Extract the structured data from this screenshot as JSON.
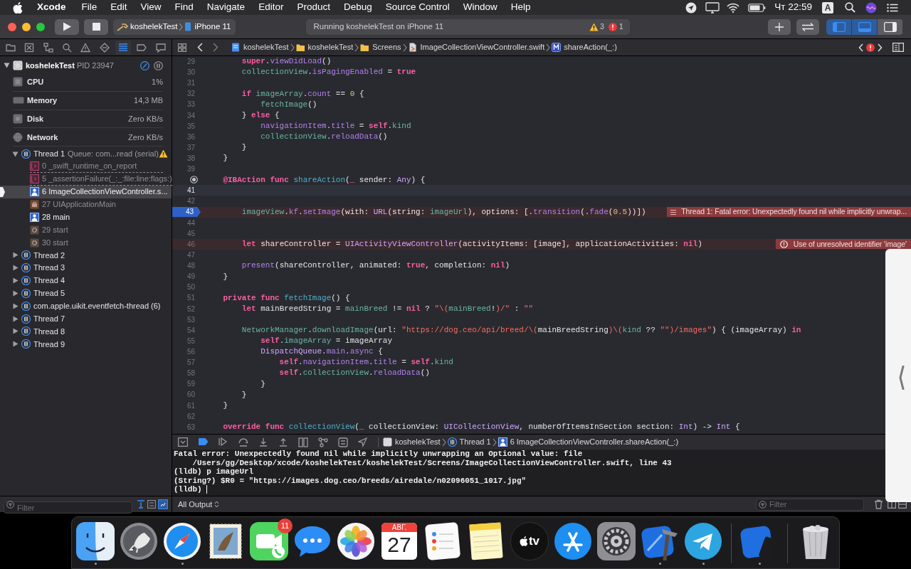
{
  "menu_bar": {
    "menus": [
      {
        "label": "Xcode",
        "kind": "app"
      },
      {
        "label": "File",
        "kind": "menu"
      },
      {
        "label": "Edit",
        "kind": "menu"
      },
      {
        "label": "View",
        "kind": "menu"
      },
      {
        "label": "Find",
        "kind": "menu"
      },
      {
        "label": "Navigate",
        "kind": "menu"
      },
      {
        "label": "Editor",
        "kind": "menu"
      },
      {
        "label": "Product",
        "kind": "menu"
      },
      {
        "label": "Debug",
        "kind": "menu"
      },
      {
        "label": "Source Control",
        "kind": "menu"
      },
      {
        "label": "Window",
        "kind": "menu"
      },
      {
        "label": "Help",
        "kind": "menu"
      }
    ],
    "clock": "Чт 22:59",
    "input_source": "A"
  },
  "toolbar": {
    "scheme": "koshelekTest",
    "device": "iPhone 11",
    "status": "Running koshelekTest on iPhone 11",
    "warnings": "3",
    "errors": "1",
    "layout_buttons": [
      {
        "kind": "navigator",
        "selected": true
      },
      {
        "kind": "debug",
        "selected": true
      },
      {
        "kind": "inspector",
        "selected": false
      }
    ]
  },
  "navigator_tabs": [
    {
      "kind": "project",
      "selected": false
    },
    {
      "kind": "source",
      "selected": false
    },
    {
      "kind": "symbols",
      "selected": false
    },
    {
      "kind": "find",
      "selected": false
    },
    {
      "kind": "issues",
      "selected": false
    },
    {
      "kind": "tests",
      "selected": false
    },
    {
      "kind": "debug",
      "selected": true
    },
    {
      "kind": "breakpoints",
      "selected": false
    },
    {
      "kind": "reports",
      "selected": false
    }
  ],
  "jump_bar": [
    {
      "label": "koshelekTest",
      "kind": "project"
    },
    {
      "label": "koshelekTest",
      "kind": "folder"
    },
    {
      "label": "Screens",
      "kind": "folder"
    },
    {
      "label": "ImageCollectionViewController.swift",
      "kind": "file"
    },
    {
      "label": "shareAction(_:)",
      "kind": "method"
    }
  ],
  "debug_navigator": {
    "process": "koshelekTest",
    "pid": "PID 23947",
    "gauges": [
      {
        "kind": "cpu",
        "label": "CPU",
        "value": "1%"
      },
      {
        "kind": "memory",
        "label": "Memory",
        "value": "14,3 MB"
      },
      {
        "kind": "disk",
        "label": "Disk",
        "value": "Zero KB/s"
      },
      {
        "kind": "network",
        "label": "Network",
        "value": "Zero KB/s"
      }
    ],
    "threads": [
      {
        "label": "Thread 1",
        "queue": "Queue: com...read (serial)",
        "expanded": true,
        "warning": true,
        "children": [
          {
            "label": "0 _swift_runtime_on_report",
            "kind": "runtime",
            "selected": false
          },
          {
            "label": "5 _assertionFailure(_:_:file:line:flags:)",
            "kind": "runtime",
            "selected": false
          },
          {
            "label": "6 ImageCollectionViewController.s...",
            "kind": "user",
            "selected": true
          },
          {
            "label": "27 UIApplicationMain",
            "kind": "framework",
            "selected": false
          },
          {
            "label": "28 main",
            "kind": "user",
            "selected": false
          },
          {
            "label": "29 start",
            "kind": "system",
            "selected": false
          },
          {
            "label": "30 start",
            "kind": "system",
            "selected": false
          }
        ]
      },
      {
        "label": "Thread 2",
        "expanded": false,
        "warning": false
      },
      {
        "label": "Thread 3",
        "expanded": false,
        "warning": false
      },
      {
        "label": "Thread 4",
        "expanded": false,
        "warning": false
      },
      {
        "label": "Thread 5",
        "expanded": false,
        "warning": false
      },
      {
        "label": "com.apple.uikit.eventfetch-thread (6)",
        "expanded": false,
        "warning": false
      },
      {
        "label": "Thread 7",
        "expanded": false,
        "warning": false
      },
      {
        "label": "Thread 8",
        "expanded": false,
        "warning": false
      },
      {
        "label": "Thread 9",
        "expanded": false,
        "warning": false
      }
    ],
    "filter": {
      "placeholder": "Filter"
    }
  },
  "editor": {
    "lines": [
      {
        "number": "29",
        "kind": "plain",
        "tokens": [
          {
            "kind": "kw",
            "text": "        super"
          },
          {
            "kind": "p",
            "text": "."
          },
          {
            "kind": "sys",
            "text": "viewDidLoad"
          },
          {
            "kind": "p",
            "text": "()"
          }
        ]
      },
      {
        "number": "30",
        "kind": "plain",
        "tokens": [
          {
            "kind": "proj",
            "text": "        collectionView"
          },
          {
            "kind": "p",
            "text": "."
          },
          {
            "kind": "sys",
            "text": "isPagingEnabled"
          },
          {
            "kind": "p",
            "text": " = "
          },
          {
            "kind": "kw",
            "text": "true"
          }
        ]
      },
      {
        "number": "31",
        "kind": "plain"
      },
      {
        "number": "32",
        "kind": "plain",
        "tokens": [
          {
            "kind": "kw",
            "text": "        if"
          },
          {
            "kind": "proj",
            "text": " imageArray"
          },
          {
            "kind": "p",
            "text": "."
          },
          {
            "kind": "sys",
            "text": "count"
          },
          {
            "kind": "p",
            "text": " == "
          },
          {
            "kind": "num",
            "text": "0"
          },
          {
            "kind": "p",
            "text": " {"
          }
        ]
      },
      {
        "number": "33",
        "kind": "plain",
        "tokens": [
          {
            "kind": "proj",
            "text": "            fetchImage"
          },
          {
            "kind": "p",
            "text": "()"
          }
        ]
      },
      {
        "number": "34",
        "kind": "plain",
        "tokens": [
          {
            "kind": "p",
            "text": "        } "
          },
          {
            "kind": "kw",
            "text": "else"
          },
          {
            "kind": "p",
            "text": " {"
          }
        ]
      },
      {
        "number": "35",
        "kind": "plain",
        "tokens": [
          {
            "kind": "sys",
            "text": "            navigationItem"
          },
          {
            "kind": "p",
            "text": "."
          },
          {
            "kind": "sys",
            "text": "title"
          },
          {
            "kind": "p",
            "text": " = "
          },
          {
            "kind": "kw",
            "text": "self"
          },
          {
            "kind": "p",
            "text": "."
          },
          {
            "kind": "proj",
            "text": "kind"
          }
        ]
      },
      {
        "number": "36",
        "kind": "plain",
        "tokens": [
          {
            "kind": "proj",
            "text": "            collectionView"
          },
          {
            "kind": "p",
            "text": "."
          },
          {
            "kind": "sys",
            "text": "reloadData"
          },
          {
            "kind": "p",
            "text": "()"
          }
        ]
      },
      {
        "number": "37",
        "kind": "plain",
        "tokens": [
          {
            "kind": "p",
            "text": "        }"
          }
        ]
      },
      {
        "number": "38",
        "kind": "plain",
        "tokens": [
          {
            "kind": "p",
            "text": "    }"
          }
        ]
      },
      {
        "number": "39",
        "kind": "plain"
      },
      {
        "kind": "outlet",
        "tokens": [
          {
            "kind": "kw",
            "text": "    @IBAction func"
          },
          {
            "kind": "decl",
            "text": " shareAction"
          },
          {
            "kind": "p",
            "text": "("
          },
          {
            "kind": "kw",
            "text": "_"
          },
          {
            "kind": "p",
            "text": " sender: "
          },
          {
            "kind": "type",
            "text": "Any"
          },
          {
            "kind": "p",
            "text": ") {"
          }
        ]
      },
      {
        "number": "41",
        "kind": "current"
      },
      {
        "number": "42",
        "kind": "plain"
      },
      {
        "number": "43",
        "kind": "stopped",
        "issue": "Thread 1: Fatal error: Unexpectedly found nil while implicitly unwrap...",
        "tokens": [
          {
            "kind": "proj",
            "text": "        imageView"
          },
          {
            "kind": "p",
            "text": "."
          },
          {
            "kind": "sys",
            "text": "kf"
          },
          {
            "kind": "p",
            "text": "."
          },
          {
            "kind": "sys",
            "text": "setImage"
          },
          {
            "kind": "p",
            "text": "(with: "
          },
          {
            "kind": "type",
            "text": "URL"
          },
          {
            "kind": "p",
            "text": "(string: "
          },
          {
            "kind": "proj",
            "text": "imageUrl"
          },
          {
            "kind": "p",
            "text": "), options: [."
          },
          {
            "kind": "sys",
            "text": "transition"
          },
          {
            "kind": "p",
            "text": "(."
          },
          {
            "kind": "sys",
            "text": "fade"
          },
          {
            "kind": "p",
            "text": "("
          },
          {
            "kind": "num",
            "text": "0.5"
          },
          {
            "kind": "p",
            "text": "))])"
          }
        ]
      },
      {
        "number": "44",
        "kind": "plain"
      },
      {
        "number": "45",
        "kind": "plain"
      },
      {
        "number": "46",
        "kind": "error",
        "issue": "Use of unresolved identifier 'image'",
        "tokens": [
          {
            "kind": "kw",
            "text": "        let"
          },
          {
            "kind": "p",
            "text": " shareController = "
          },
          {
            "kind": "type",
            "text": "UIActivityViewController"
          },
          {
            "kind": "p",
            "text": "(activityItems: [image], applicationActivities: "
          },
          {
            "kind": "kw",
            "text": "nil"
          },
          {
            "kind": "p",
            "text": ")"
          }
        ]
      },
      {
        "number": "47",
        "kind": "plain"
      },
      {
        "number": "48",
        "kind": "plain",
        "tokens": [
          {
            "kind": "sys",
            "text": "        present"
          },
          {
            "kind": "p",
            "text": "(shareController, animated: "
          },
          {
            "kind": "kw",
            "text": "true"
          },
          {
            "kind": "p",
            "text": ", completion: "
          },
          {
            "kind": "kw",
            "text": "nil"
          },
          {
            "kind": "p",
            "text": ")"
          }
        ]
      },
      {
        "number": "49",
        "kind": "plain",
        "tokens": [
          {
            "kind": "p",
            "text": "    }"
          }
        ]
      },
      {
        "number": "50",
        "kind": "plain"
      },
      {
        "number": "51",
        "kind": "plain",
        "tokens": [
          {
            "kind": "kw",
            "text": "    private func"
          },
          {
            "kind": "decl",
            "text": " fetchImage"
          },
          {
            "kind": "p",
            "text": "() {"
          }
        ]
      },
      {
        "number": "52",
        "kind": "plain",
        "tokens": [
          {
            "kind": "kw",
            "text": "        let"
          },
          {
            "kind": "p",
            "text": " mainBreedString = "
          },
          {
            "kind": "proj",
            "text": "mainBreed"
          },
          {
            "kind": "p",
            "text": " != "
          },
          {
            "kind": "kw",
            "text": "nil"
          },
          {
            "kind": "p",
            "text": " ? "
          },
          {
            "kind": "str",
            "text": "\"\\("
          },
          {
            "kind": "proj",
            "text": "mainBreed"
          },
          {
            "kind": "p",
            "text": "!"
          },
          {
            "kind": "str",
            "text": ")/\""
          },
          {
            "kind": "p",
            "text": " : "
          },
          {
            "kind": "str",
            "text": "\"\""
          }
        ]
      },
      {
        "number": "53",
        "kind": "plain"
      },
      {
        "number": "54",
        "kind": "plain",
        "tokens": [
          {
            "kind": "proj",
            "text": "        NetworkManager"
          },
          {
            "kind": "p",
            "text": "."
          },
          {
            "kind": "proj",
            "text": "downloadImage"
          },
          {
            "kind": "p",
            "text": "(url: "
          },
          {
            "kind": "str",
            "text": "\"https://dog.ceo/api/breed/\\("
          },
          {
            "kind": "p",
            "text": "mainBreedString"
          },
          {
            "kind": "str",
            "text": ")\\("
          },
          {
            "kind": "proj",
            "text": "kind"
          },
          {
            "kind": "p",
            "text": " ?? "
          },
          {
            "kind": "str",
            "text": "\"\""
          },
          {
            "kind": "str",
            "text": ")/images\""
          },
          {
            "kind": "p",
            "text": ") { (imageArray) "
          },
          {
            "kind": "kw",
            "text": "in"
          }
        ]
      },
      {
        "number": "55",
        "kind": "plain",
        "tokens": [
          {
            "kind": "kw",
            "text": "            self"
          },
          {
            "kind": "p",
            "text": "."
          },
          {
            "kind": "proj",
            "text": "imageArray"
          },
          {
            "kind": "p",
            "text": " = imageArray"
          }
        ]
      },
      {
        "number": "56",
        "kind": "plain",
        "tokens": [
          {
            "kind": "type",
            "text": "            DispatchQueue"
          },
          {
            "kind": "p",
            "text": "."
          },
          {
            "kind": "sys",
            "text": "main"
          },
          {
            "kind": "p",
            "text": "."
          },
          {
            "kind": "sys",
            "text": "async"
          },
          {
            "kind": "p",
            "text": " {"
          }
        ]
      },
      {
        "number": "57",
        "kind": "plain",
        "tokens": [
          {
            "kind": "kw",
            "text": "                self"
          },
          {
            "kind": "p",
            "text": "."
          },
          {
            "kind": "sys",
            "text": "navigationItem"
          },
          {
            "kind": "p",
            "text": "."
          },
          {
            "kind": "sys",
            "text": "title"
          },
          {
            "kind": "p",
            "text": " = "
          },
          {
            "kind": "kw",
            "text": "self"
          },
          {
            "kind": "p",
            "text": "."
          },
          {
            "kind": "proj",
            "text": "kind"
          }
        ]
      },
      {
        "number": "58",
        "kind": "plain",
        "tokens": [
          {
            "kind": "kw",
            "text": "                self"
          },
          {
            "kind": "p",
            "text": "."
          },
          {
            "kind": "proj",
            "text": "collectionView"
          },
          {
            "kind": "p",
            "text": "."
          },
          {
            "kind": "sys",
            "text": "reloadData"
          },
          {
            "kind": "p",
            "text": "()"
          }
        ]
      },
      {
        "number": "59",
        "kind": "plain",
        "tokens": [
          {
            "kind": "p",
            "text": "            }"
          }
        ]
      },
      {
        "number": "60",
        "kind": "plain",
        "tokens": [
          {
            "kind": "p",
            "text": "        }"
          }
        ]
      },
      {
        "number": "61",
        "kind": "plain",
        "tokens": [
          {
            "kind": "p",
            "text": "    }"
          }
        ]
      },
      {
        "number": "62",
        "kind": "plain"
      },
      {
        "number": "63",
        "kind": "plain",
        "tokens": [
          {
            "kind": "kw",
            "text": "    override func"
          },
          {
            "kind": "decl",
            "text": " collectionView"
          },
          {
            "kind": "p",
            "text": "("
          },
          {
            "kind": "kw",
            "text": "_"
          },
          {
            "kind": "p",
            "text": " collectionView: "
          },
          {
            "kind": "type",
            "text": "UICollectionView"
          },
          {
            "kind": "p",
            "text": ", numberOfItemsInSection section: "
          },
          {
            "kind": "type",
            "text": "Int"
          },
          {
            "kind": "p",
            "text": ") -> "
          },
          {
            "kind": "type",
            "text": "Int"
          },
          {
            "kind": "p",
            "text": " {"
          }
        ]
      }
    ]
  },
  "debug_bar": {
    "breakpoints_active": true,
    "path": [
      {
        "label": "koshelekTest",
        "kind": "app"
      },
      {
        "label": "Thread 1",
        "kind": "thread"
      },
      {
        "label": "6 ImageCollectionViewController.shareAction(_:)",
        "kind": "frame"
      }
    ]
  },
  "console": {
    "lines": [
      "Fatal error: Unexpectedly found nil while implicitly unwrapping an Optional value: file",
      "    /Users/gg/Desktop/xcode/koshelekTest/koshelekTest/Screens/ImageCollectionViewController.swift, line 43",
      "(lldb) p imageUrl",
      "(String?) $R0 = \"https://images.dog.ceo/breeds/airedale/n02096051_1017.jpg\"",
      "(lldb) "
    ],
    "output_menu": "All Output",
    "filter": {
      "placeholder": "Filter"
    }
  },
  "dock": {
    "items": [
      {
        "kind": "finder",
        "running": true
      },
      {
        "kind": "launchpad",
        "running": false
      },
      {
        "kind": "safari",
        "running": true
      },
      {
        "kind": "mail",
        "running": false
      },
      {
        "kind": "facetime",
        "running": false,
        "badge": "11"
      },
      {
        "kind": "messages",
        "running": false
      },
      {
        "kind": "photos",
        "running": false
      },
      {
        "kind": "calendar",
        "running": false,
        "month": "АВГ.",
        "day": "27"
      },
      {
        "kind": "reminders",
        "running": false
      },
      {
        "kind": "notes",
        "running": false
      },
      {
        "kind": "tv",
        "running": false,
        "label": "tv"
      },
      {
        "kind": "appstore",
        "running": false
      },
      {
        "kind": "settings",
        "running": false
      },
      {
        "kind": "xcode",
        "running": true
      },
      {
        "kind": "telegram",
        "running": true
      },
      {
        "kind": "separator"
      },
      {
        "kind": "simulator",
        "running": true
      },
      {
        "kind": "separator"
      },
      {
        "kind": "trash",
        "running": false
      }
    ]
  }
}
